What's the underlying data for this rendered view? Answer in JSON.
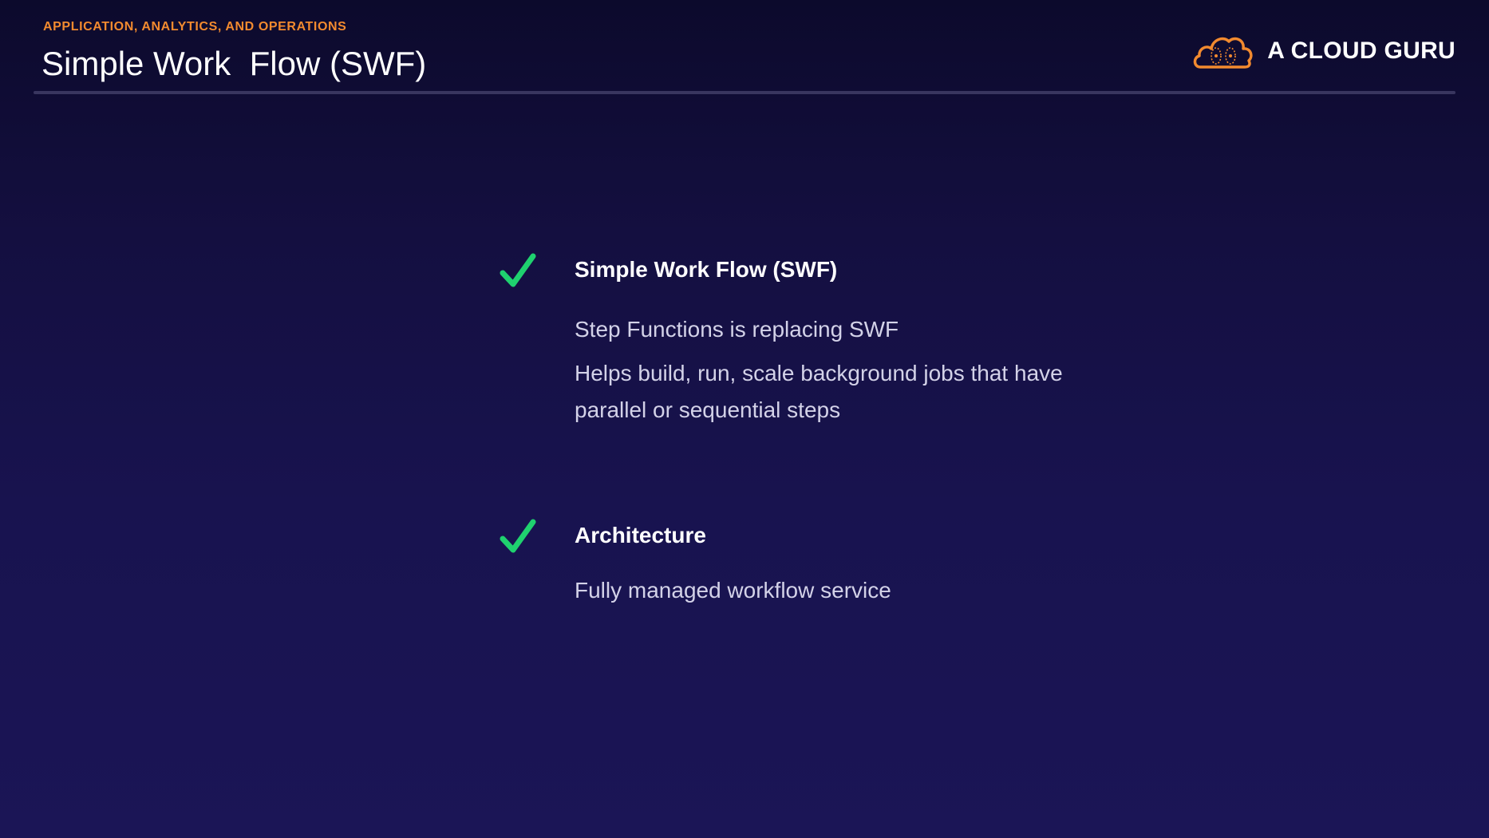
{
  "header": {
    "section": "APPLICATION, ANALYTICS, AND OPERATIONS",
    "title": "Simple Work  Flow (SWF)",
    "brand": "A CLOUD GURU"
  },
  "colors": {
    "accent_orange": "#f28a2f",
    "check_green": "#1fd16f",
    "background_top": "#0c0a2c",
    "background_bottom": "#1b1556"
  },
  "items": [
    {
      "icon": "checkmark-icon",
      "heading": "Simple Work Flow (SWF)",
      "lines": [
        "Step Functions is replacing SWF",
        "Helps build, run, scale background jobs that have parallel or sequential steps"
      ]
    },
    {
      "icon": "checkmark-icon",
      "heading": "Architecture",
      "lines": [
        "Fully managed workflow service"
      ]
    }
  ]
}
